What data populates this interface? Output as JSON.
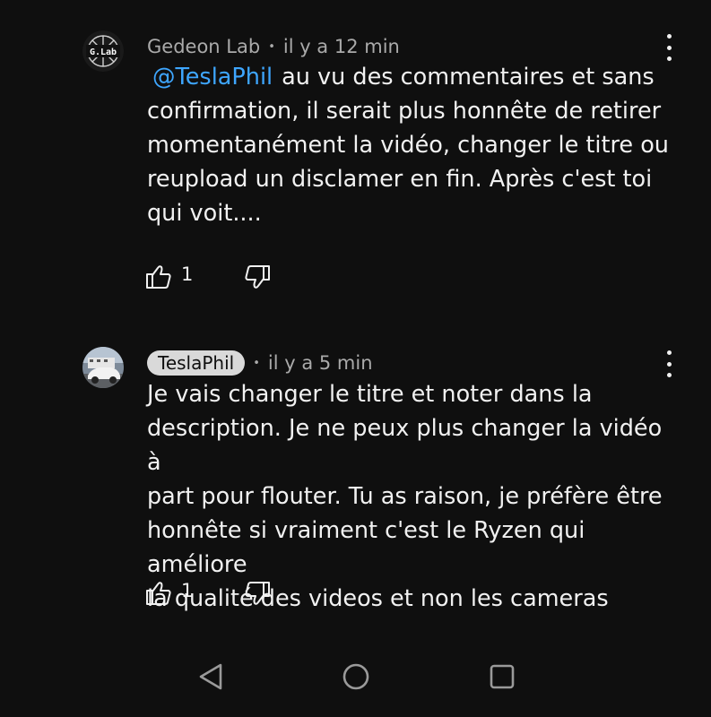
{
  "comments": [
    {
      "author": "Gedeon Lab",
      "avatar_text": "G.Lab",
      "author_is_creator": false,
      "time": "il y a 12 min",
      "mention": "@TeslaPhil",
      "lines": [
        "au vu des commentaires et sans",
        "confirmation, il serait plus honnête de retirer",
        "momentanément la vidéo, changer le titre ou",
        "reupload un disclamer en fin. Après c'est toi",
        "qui voit...."
      ],
      "likes": "1",
      "icons": {
        "like": "thumbs-up-icon",
        "dislike": "thumbs-down-icon",
        "menu": "more-vert-icon"
      }
    },
    {
      "author": "TeslaPhil",
      "author_is_creator": true,
      "time": "il y a 5 min",
      "lines": [
        "Je vais changer le titre et noter dans la",
        "description. Je ne peux plus changer la vidéo à",
        "part pour flouter. Tu as raison, je préfère être",
        "honnête si vraiment c'est le Ryzen qui améliore",
        "la qualité des videos et non les cameras"
      ],
      "likes": "1",
      "icons": {
        "like": "thumbs-up-icon",
        "dislike": "thumbs-down-icon",
        "menu": "more-vert-icon"
      }
    }
  ],
  "navigation": {
    "buttons": [
      "back-icon",
      "home-icon",
      "recents-icon"
    ]
  },
  "colors": {
    "background": "#0f0f0f",
    "text": "#f1f1f1",
    "meta": "#aaaaaa",
    "mention": "#3ea6ff",
    "creator_pill": "#d9d9d9"
  }
}
